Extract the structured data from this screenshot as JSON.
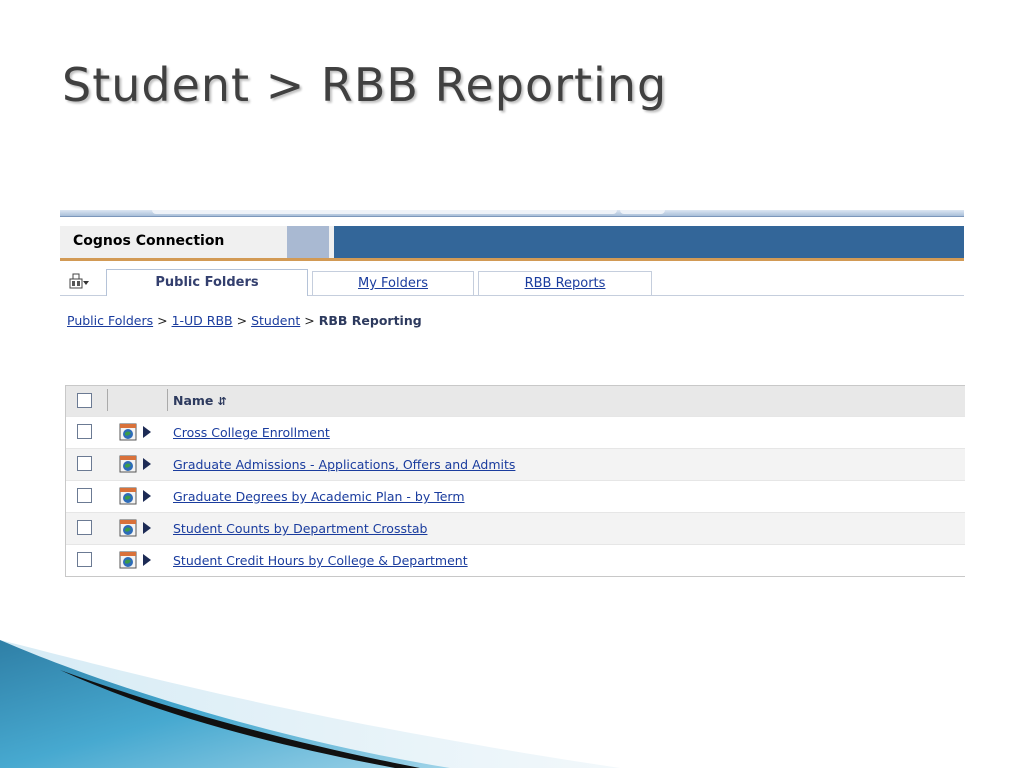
{
  "slide": {
    "title": "Student > RBB Reporting"
  },
  "app": {
    "name": "Cognos Connection"
  },
  "tabs": [
    {
      "label": "Public Folders",
      "active": true
    },
    {
      "label": "My Folders",
      "active": false
    },
    {
      "label": "RBB Reports",
      "active": false
    }
  ],
  "breadcrumb": {
    "links": [
      "Public Folders",
      "1-UD RBB",
      "Student"
    ],
    "separator": ">",
    "current": "RBB Reporting"
  },
  "list": {
    "column_name": "Name",
    "items": [
      "Cross College Enrollment",
      "Graduate Admissions - Applications, Offers and Admits",
      "Graduate Degrees by Academic Plan - by Term",
      "Student Counts by Department Crosstab",
      "Student Credit Hours by College & Department"
    ]
  },
  "icons": {
    "tab_icon": "folder-tree-icon",
    "report_icon": "report-view-icon",
    "action_icon": "run-arrow-icon",
    "sort_icon": "sort-icon"
  },
  "colors": {
    "header_bar": "#336699",
    "header_accent": "#d29a55",
    "link": "#1a3c9e",
    "title_text": "#404040"
  }
}
